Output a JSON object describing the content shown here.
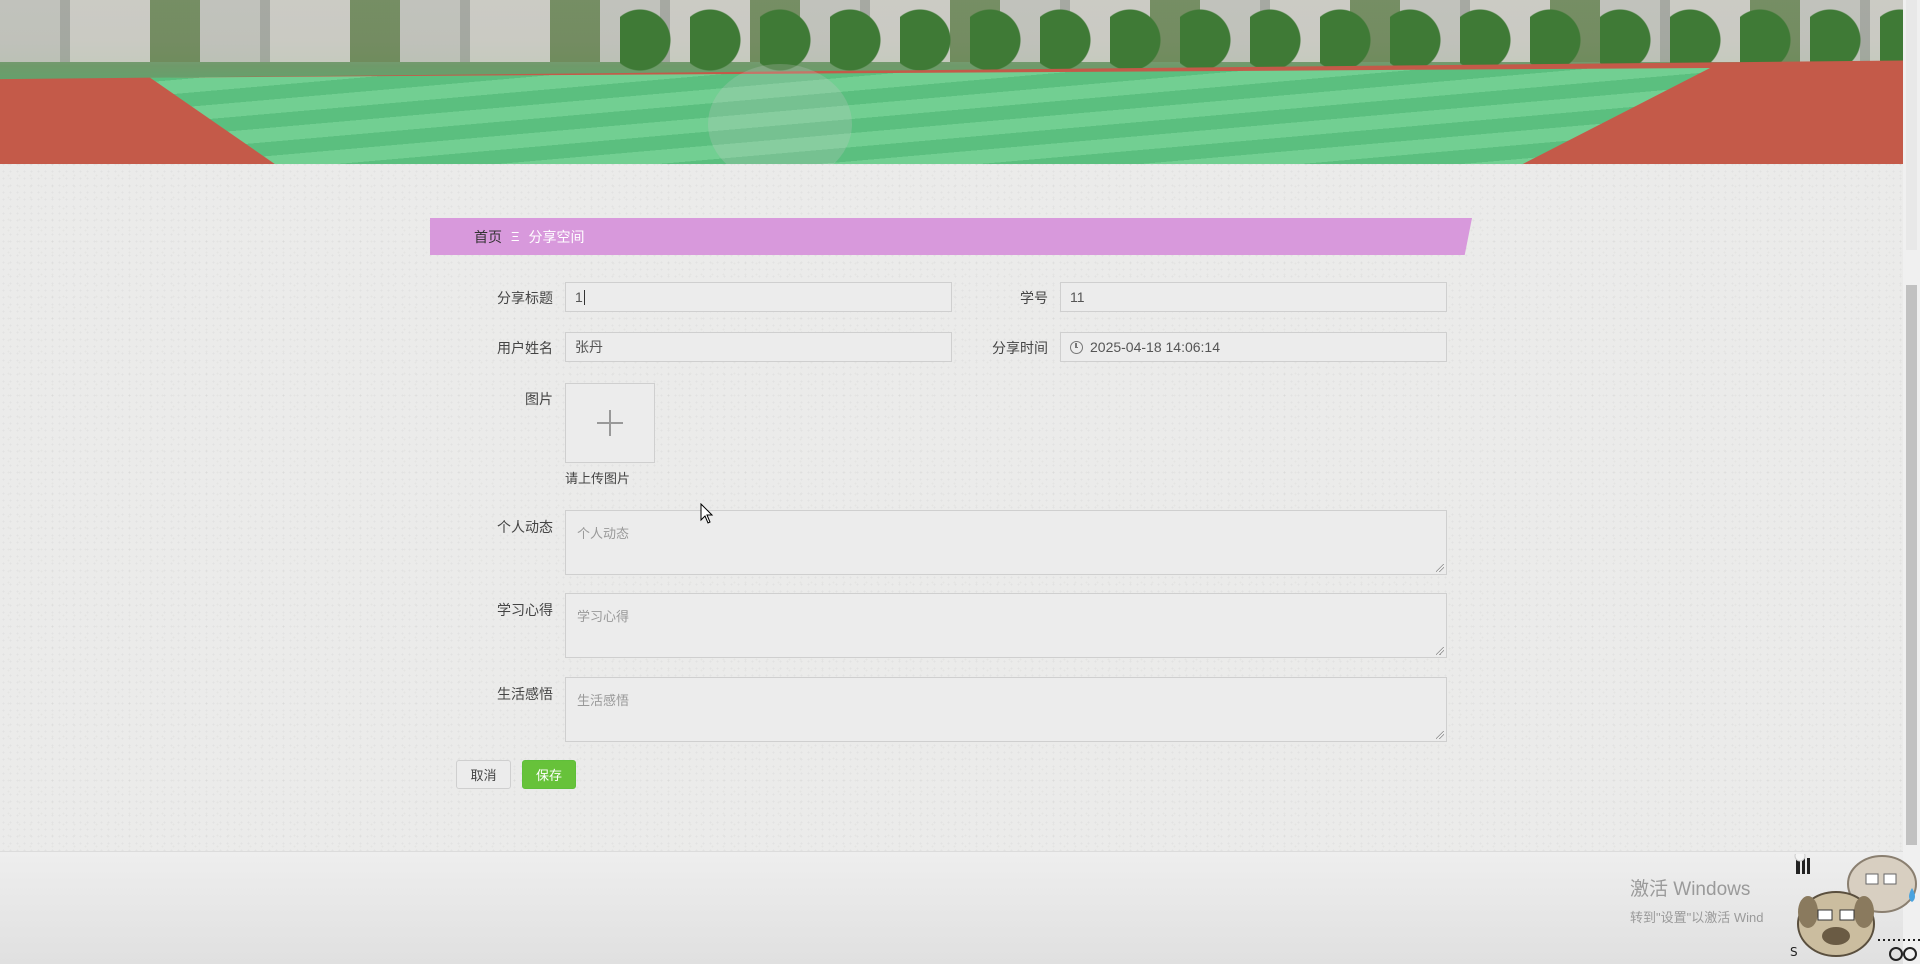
{
  "breadcrumb": {
    "home": "首页",
    "separator": "Ξ",
    "current": "分享空间"
  },
  "form": {
    "share_title": {
      "label": "分享标题",
      "value": "1"
    },
    "student_id": {
      "label": "学号",
      "value": "11"
    },
    "user_name": {
      "label": "用户姓名",
      "value": "张丹"
    },
    "share_time": {
      "label": "分享时间",
      "value": "2025-04-18 14:06:14"
    },
    "image": {
      "label": "图片",
      "hint": "请上传图片"
    },
    "personal_updates": {
      "label": "个人动态",
      "placeholder": "个人动态"
    },
    "study_notes": {
      "label": "学习心得",
      "placeholder": "学习心得"
    },
    "life_insights": {
      "label": "生活感悟",
      "placeholder": "生活感悟"
    }
  },
  "buttons": {
    "cancel": "取消",
    "save": "保存"
  },
  "windows_activation": {
    "title": "激活 Windows",
    "subtitle": "转到\"设置\"以激活 Wind"
  },
  "colors": {
    "breadcrumb_bg": "#d899dc",
    "save_button": "#67c23a",
    "page_bg": "#ebebea"
  },
  "icons": {
    "upload": "plus-icon",
    "time": "clock-icon"
  }
}
